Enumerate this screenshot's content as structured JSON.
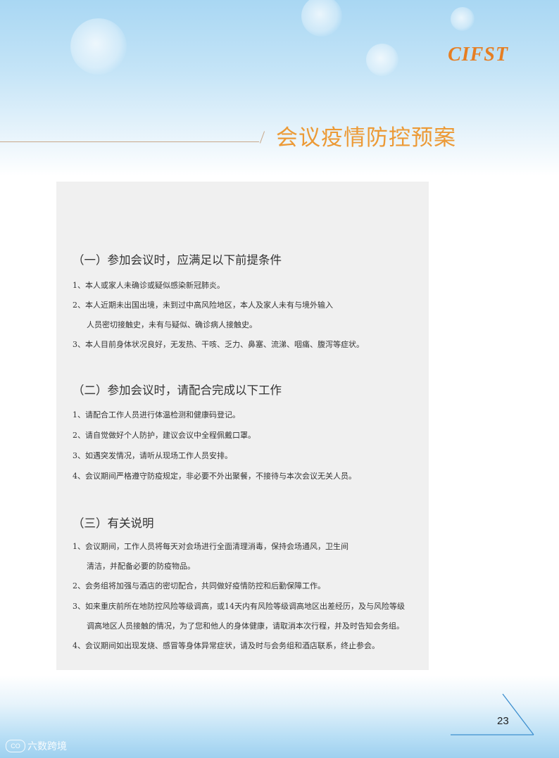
{
  "header": {
    "logo": "CIFST",
    "title": "会议疫情防控预案",
    "colors": {
      "accent": "#ec9a36",
      "logo": "#e67e22",
      "band": "#a9d7f3"
    }
  },
  "sections": [
    {
      "heading": "（一）参加会议时，应满足以下前提条件",
      "lines": [
        "1、本人或家人未确诊或疑似感染新冠肺炎。",
        "2、本人近期未出国出境，未到过中高风险地区，本人及家人未有与境外输入",
        "人员密切接触史，未有与疑似、确诊病人接触史。",
        "3、本人目前身体状况良好，无发热、干咳、乏力、鼻塞、流涕、咽痛、腹泻等症状。"
      ]
    },
    {
      "heading": "（二）参加会议时，请配合完成以下工作",
      "lines": [
        "1、请配合工作人员进行体温检测和健康码登记。",
        "2、请自觉做好个人防护，建议会议中全程佩戴口罩。",
        "3、如遇突发情况，请听从现场工作人员安排。",
        "4、会议期间严格遵守防疫规定，非必要不外出聚餐，不接待与本次会议无关人员。"
      ]
    },
    {
      "heading": "（三）有关说明",
      "lines": [
        "1、会议期间，工作人员将每天对会场进行全面清理消毒，保持会场通风，卫生间",
        "清洁，并配备必要的防疫物品。",
        "2、会务组将加强与酒店的密切配合，共同做好疫情防控和后勤保障工作。",
        "3、如来重庆前所在地防控风险等级调高，或14天内有风险等级调高地区出差经历，及与风险等级",
        "调高地区人员接触的情况，为了您和他人的身体健康，请取消本次行程，并及时告知会务组。",
        "4、会议期间如出现发烧、感冒等身体异常症状，请及时与会务组和酒店联系，终止参会。"
      ]
    }
  ],
  "footer": {
    "page_number": "23",
    "watermark_icon": "CO",
    "watermark_text": "六数跨境"
  }
}
